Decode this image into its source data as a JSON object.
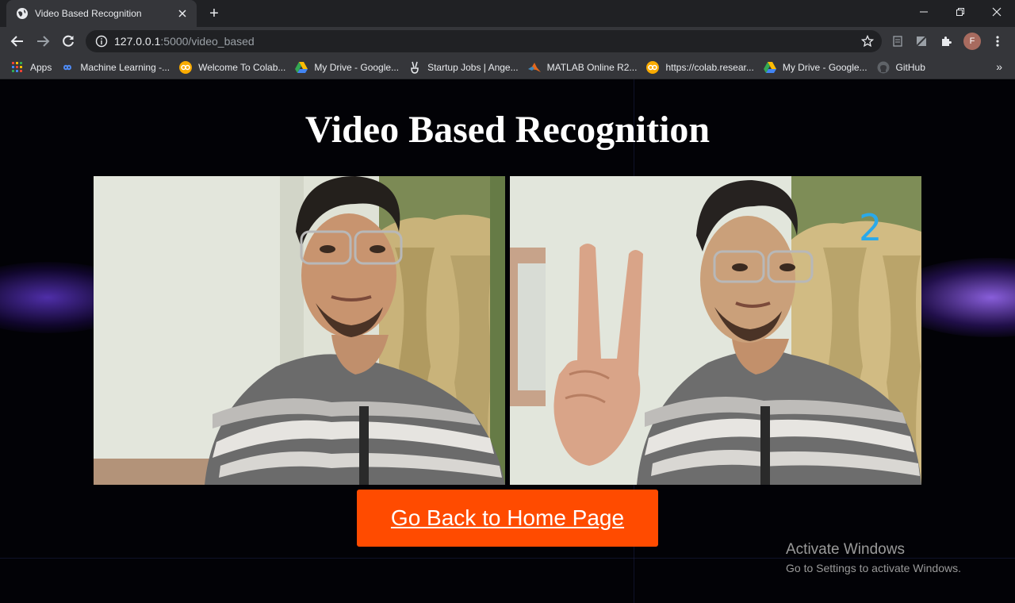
{
  "browser": {
    "tab_title": "Video Based Recognition",
    "new_tab_symbol": "+",
    "url_host": "127.0.0.1",
    "url_rest": ":5000/video_based",
    "profile_initial": "F",
    "bookmarks_more": "»",
    "bookmarks": [
      {
        "label": "Apps",
        "icon": "apps-grid-icon"
      },
      {
        "label": "Machine Learning -...",
        "icon": "infinity-icon"
      },
      {
        "label": "Welcome To Colab...",
        "icon": "colab-icon"
      },
      {
        "label": "My Drive - Google...",
        "icon": "google-drive-icon"
      },
      {
        "label": "Startup Jobs | Ange...",
        "icon": "victory-hand-icon"
      },
      {
        "label": "MATLAB Online R2...",
        "icon": "matlab-icon"
      },
      {
        "label": "https://colab.resear...",
        "icon": "colab-icon"
      },
      {
        "label": "My Drive - Google...",
        "icon": "google-drive-icon"
      },
      {
        "label": "GitHub",
        "icon": "github-icon"
      }
    ]
  },
  "page": {
    "heading": "Video Based Recognition",
    "gesture_count": "2",
    "home_button_label": "Go Back to Home Page",
    "watermark_title": "Activate Windows",
    "watermark_subtitle": "Go to Settings to activate Windows."
  },
  "colors": {
    "button": "#ff4b00",
    "count_text": "#2aa9ea",
    "chrome_dark": "#202124",
    "chrome_mid": "#35363a"
  }
}
